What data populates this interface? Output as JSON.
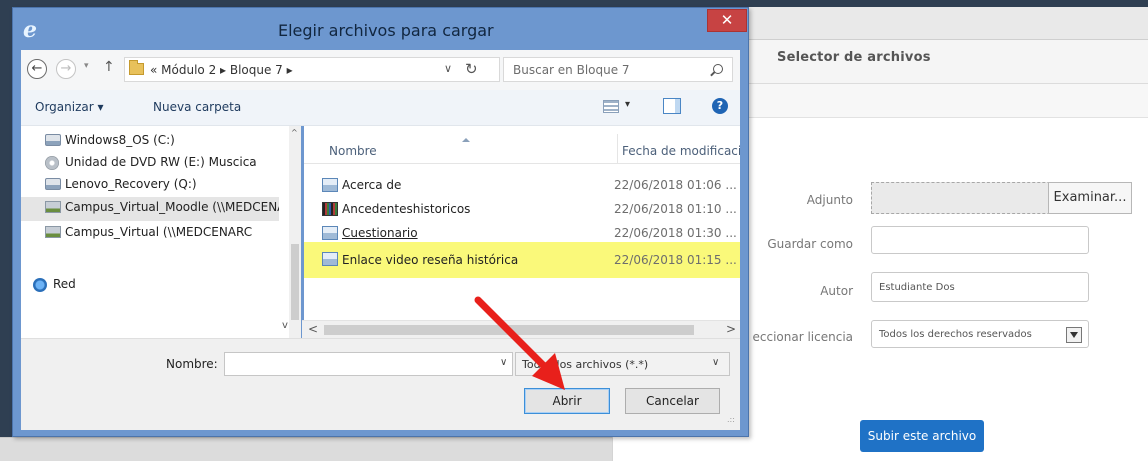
{
  "dialog": {
    "title": "Elegir archivos para cargar",
    "close_label": "✕",
    "app_icon": "internet-explorer-icon",
    "nav": {
      "back": "←",
      "forward": "→",
      "recent": "▾",
      "up": "↑",
      "breadcrumb": "« Módulo 2 ▸ Bloque 7 ▸",
      "address_dropdown": "∨",
      "refresh": "↻",
      "search_placeholder": "Buscar en Bloque 7"
    },
    "toolbar": {
      "organize": "Organizar ▾",
      "new_folder": "Nueva carpeta",
      "view_dropdown": "▾",
      "help": "?"
    },
    "nav_pane": {
      "items": [
        {
          "label": "Windows8_OS (C:)",
          "icon": "drive-icon"
        },
        {
          "label": "Unidad de DVD RW (E:) Muscica",
          "icon": "dvd-drive-icon"
        },
        {
          "label": "Lenovo_Recovery (Q:)",
          "icon": "drive-icon"
        },
        {
          "label": "Campus_Virtual_Moodle (\\\\MEDCENARC",
          "icon": "network-drive-icon"
        },
        {
          "label": "Campus_Virtual (\\\\MEDCENARC",
          "icon": "network-drive-icon"
        },
        {
          "label": "Red",
          "icon": "network-icon"
        }
      ],
      "scroll_up": "^",
      "scroll_down": "v"
    },
    "file_list": {
      "columns": {
        "name": "Nombre",
        "date": "Fecha de modificación"
      },
      "rows": [
        {
          "name": "Acerca de",
          "date": "22/06/2018 01:06 ...",
          "icon": "document-icon",
          "highlighted": false
        },
        {
          "name": "Ancedenteshistoricos",
          "date": "22/06/2018 01:10 ...",
          "icon": "video-file-icon",
          "highlighted": false
        },
        {
          "name": "Cuestionario",
          "date": "22/06/2018 01:30 ...",
          "icon": "document-icon",
          "highlighted": false
        },
        {
          "name": "Enlace video reseña histórica",
          "date": "22/06/2018 01:15 ...",
          "icon": "document-icon",
          "highlighted": true
        }
      ],
      "scroll_left": "<",
      "scroll_right": ">",
      "corner_caret": "v"
    },
    "bottom": {
      "name_label": "Nombre:",
      "name_value": "",
      "name_dropdown": "∨",
      "file_type": "Todos los archivos (*.*)",
      "file_type_dropdown": "∨",
      "open_button": "Abrir",
      "cancel_button": "Cancelar",
      "grip": ".::"
    }
  },
  "moodle": {
    "header_title": "Selector de archivos",
    "labels": {
      "attachment": "Adjunto",
      "save_as": "Guardar como",
      "author": "Autor",
      "license": "eccionar licencia"
    },
    "browse_button": "Examinar...",
    "save_as_value": "",
    "author_value": "Estudiante Dos",
    "license_value": "Todos los derechos reservados",
    "upload_button": "Subir este archivo"
  },
  "annotation": {
    "arrow_color": "#e8201b",
    "highlight_color": "#faf97a"
  },
  "colors": {
    "dialog_frame": "#6d97cf",
    "close_button": "#c74343",
    "moodle_primary": "#1f72c6"
  }
}
